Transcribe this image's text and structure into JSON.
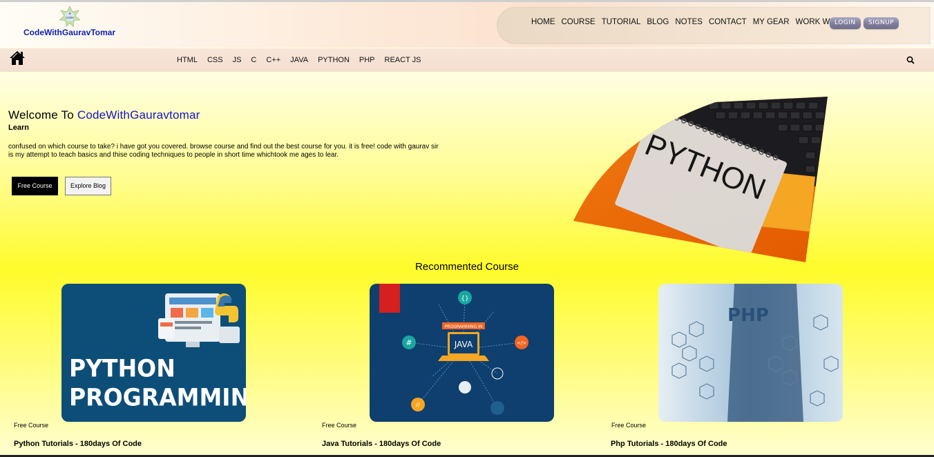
{
  "header": {
    "logo_text": "CodeWithGauravTomar",
    "logo_badge_text": "coder",
    "nav": [
      "HOME",
      "COURSE",
      "TUTORIAL",
      "BLOG",
      "NOTES",
      "CONTACT",
      "MY GEAR",
      "WORK WITH US"
    ],
    "login_label": "LOGIN",
    "signup_label": "SIGNUP"
  },
  "subnav": {
    "items": [
      "HTML",
      "CSS",
      "JS",
      "C",
      "C++",
      "JAVA",
      "PYTHON",
      "PHP",
      "REACT JS"
    ]
  },
  "hero": {
    "welcome_prefix": "Welcome To ",
    "brand": "CodeWithGauravtomar",
    "learn": "Learn",
    "description": "confused on which course to take? i have got you covered. browse course and find out the best course for you. it is free! code with gaurav sir is my attempt to teach basics and thise coding techniques to people in short time whichtook me ages to lear.",
    "free_course_label": "Free Course",
    "explore_blog_label": "Explore Blog",
    "image_word": "PYTHON"
  },
  "recommended": {
    "title": "Recommented Course",
    "cards": [
      {
        "tag": "Free Course",
        "title": "Python Tutorials - 180days Of Code",
        "image_line1": "PYTHON",
        "image_line2": "PROGRAMMING"
      },
      {
        "tag": "Free Course",
        "title": "Java Tutorials - 180days Of Code",
        "image_banner": "PROGRAMMING IN",
        "image_word": "JAVA"
      },
      {
        "tag": "Free Course",
        "title": "Php Tutorials - 180days Of Code",
        "image_word": "PHP"
      }
    ]
  },
  "colors": {
    "brand_blue": "#1414c8",
    "button_dark": "#000000",
    "card_blue": "#0f3f6e"
  }
}
